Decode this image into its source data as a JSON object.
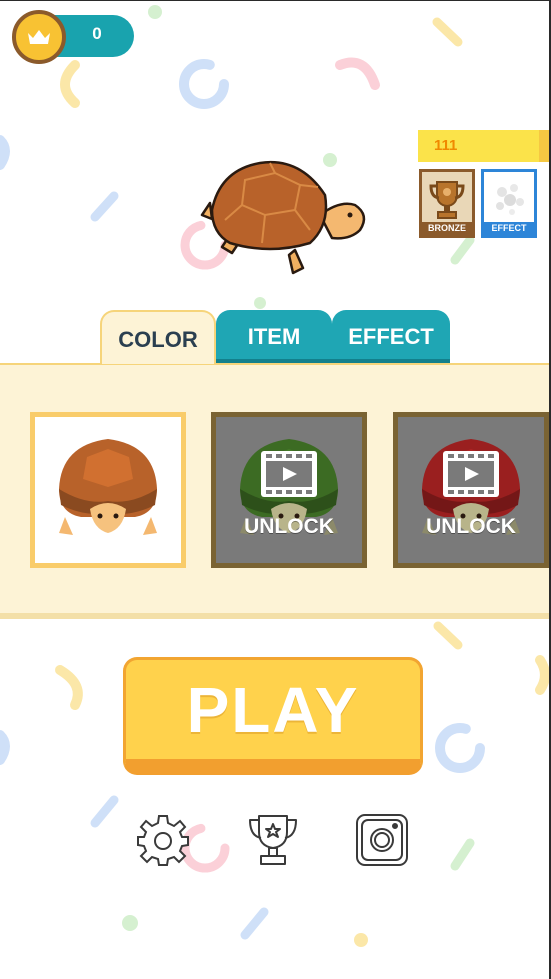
{
  "hud": {
    "crown_score": "0",
    "trophy_progress": "111",
    "trophy_progress_fraction": 0.91
  },
  "badges": [
    {
      "label": "BRONZE",
      "icon": "trophy-icon"
    },
    {
      "label": "EFFECT",
      "icon": "effect-icon"
    }
  ],
  "tabs": [
    {
      "label": "COLOR",
      "selected": true
    },
    {
      "label": "ITEM",
      "selected": false
    },
    {
      "label": "EFFECT",
      "selected": false
    }
  ],
  "skins": [
    {
      "color": "#b8622a",
      "locked": false,
      "selected": true,
      "label": ""
    },
    {
      "color": "#3c6b23",
      "locked": true,
      "selected": false,
      "label": "UNLOCK"
    },
    {
      "color": "#9a1f1f",
      "locked": true,
      "selected": false,
      "label": "UNLOCK"
    }
  ],
  "play_button": {
    "label": "PLAY"
  },
  "bottom_icons": [
    "gear-icon",
    "trophy-icon",
    "camera-icon"
  ],
  "colors": {
    "teal": "#1fa6b4",
    "gold": "#ffd24c",
    "panel": "#fdf3d6",
    "shell": "#b8622a"
  }
}
